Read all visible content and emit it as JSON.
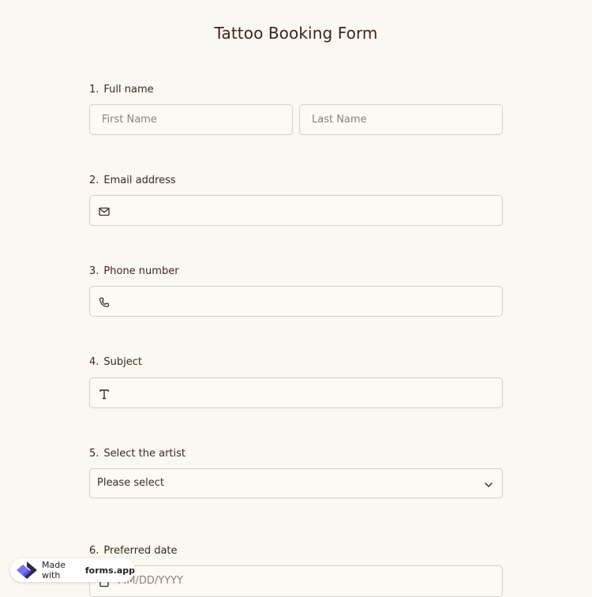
{
  "form": {
    "title": "Tattoo Booking Form",
    "questions": [
      {
        "num": "1.",
        "label": "Full name",
        "first_placeholder": "First Name",
        "last_placeholder": "Last Name"
      },
      {
        "num": "2.",
        "label": "Email address",
        "icon": "mail-icon"
      },
      {
        "num": "3.",
        "label": "Phone number",
        "icon": "phone-icon"
      },
      {
        "num": "4.",
        "label": "Subject",
        "icon": "text-icon"
      },
      {
        "num": "5.",
        "label": "Select the artist",
        "selected": "Please select"
      },
      {
        "num": "6.",
        "label": "Preferred date",
        "placeholder": "MM/DD/YYYY",
        "icon": "calendar-icon"
      }
    ]
  },
  "badge": {
    "prefix": "Made with",
    "brand": "forms.app"
  },
  "colors": {
    "background": "#fbf7f1",
    "title": "#3b2619",
    "border": "#d8cfc6",
    "logo": "#5b4fe0"
  }
}
